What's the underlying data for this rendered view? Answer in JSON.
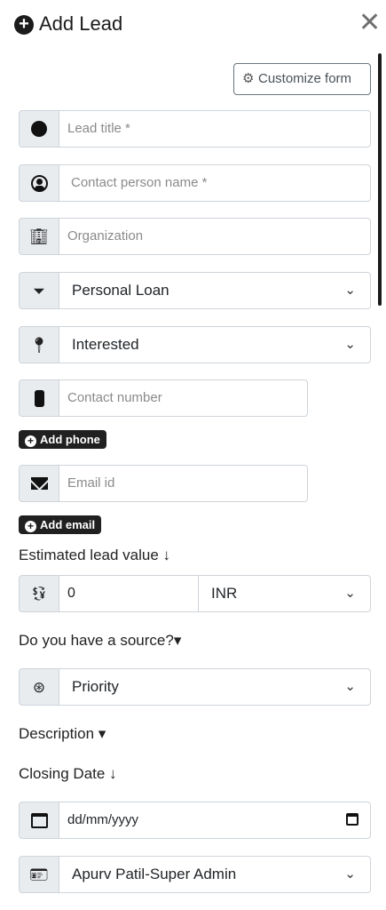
{
  "header": {
    "title": "Add Lead",
    "close_icon": "close-icon"
  },
  "toolbar": {
    "customize_label": "Customize form"
  },
  "form": {
    "lead_title_placeholder": "Lead title *",
    "contact_person_placeholder": "Contact person name *",
    "organization_placeholder": "Organization",
    "pipeline_value": "Personal Loan",
    "status_value": "Interested",
    "contact_number_placeholder": "Contact number",
    "add_phone_label": "Add phone",
    "email_placeholder": "Email id",
    "add_email_label": "Add email",
    "estimated_value_label": "Estimated lead value ↓",
    "estimated_value": "0",
    "currency_value": "INR",
    "source_label": "Do you have a source?▾",
    "priority_value": "Priority",
    "description_label": "Description ▾",
    "closing_date_label": "Closing Date ↓",
    "closing_date_placeholder": "dd/mm/yyyy",
    "owner_value": "Apurv Patil-Super Admin"
  },
  "colors": {
    "addon_bg": "#e9ecef",
    "border": "#ced4da",
    "pill_bg": "#202020"
  }
}
